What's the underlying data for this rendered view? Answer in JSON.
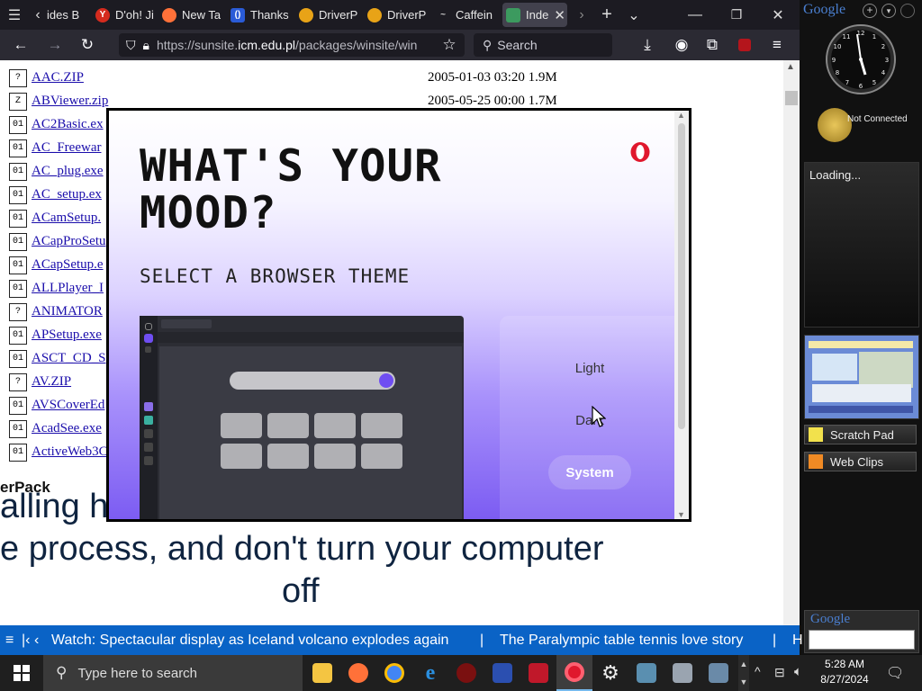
{
  "browser": {
    "tabs": [
      {
        "label": "ides B",
        "icon": "list-icon",
        "color": "#555555"
      },
      {
        "label": "D'oh! Ji",
        "icon": "yandex-icon",
        "color": "#d52b1e"
      },
      {
        "label": "New Ta",
        "icon": "firefox-icon",
        "color": "#ff7139"
      },
      {
        "label": "Thanks",
        "icon": "site-icon",
        "color": "#2a5bd7"
      },
      {
        "label": "DriverP",
        "icon": "driverpack-icon",
        "color": "#e8a317"
      },
      {
        "label": "DriverP",
        "icon": "driverpack-icon",
        "color": "#e8a317"
      },
      {
        "label": "Caffein",
        "icon": "coffee-icon",
        "color": "#444444"
      },
      {
        "label": "Inde",
        "icon": "image-icon",
        "color": "#3c9a5f",
        "active": true
      }
    ],
    "url_prefix": "https://sunsite.",
    "url_domain": "icm.edu.pl",
    "url_path": "/packages/winsite/win",
    "search_placeholder": "Search"
  },
  "listing": [
    {
      "name": "AAC.ZIP",
      "meta": "2005-01-03 03:20  1.9M",
      "icon": "?"
    },
    {
      "name": "ABViewer.zip",
      "meta": "2005-05-25 00:00  1.7M",
      "icon": "Z"
    },
    {
      "name": "AC2Basic.ex",
      "meta": "",
      "icon": "01"
    },
    {
      "name": "AC_Freewar",
      "meta": "",
      "icon": "01"
    },
    {
      "name": "AC_plug.exe",
      "meta": "",
      "icon": "01"
    },
    {
      "name": "AC_setup.ex",
      "meta": "",
      "icon": "01"
    },
    {
      "name": "ACamSetup.",
      "meta": "",
      "icon": "01"
    },
    {
      "name": "ACapProSetu",
      "meta": "",
      "icon": "01"
    },
    {
      "name": "ACapSetup.e",
      "meta": "",
      "icon": "01"
    },
    {
      "name": "ALLPlayer_I",
      "meta": "",
      "icon": "01"
    },
    {
      "name": "ANIMATOR",
      "meta": "",
      "icon": "?"
    },
    {
      "name": "APSetup.exe",
      "meta": "",
      "icon": "01"
    },
    {
      "name": "ASCT_CD_S",
      "meta": "",
      "icon": "01"
    },
    {
      "name": "AV.ZIP",
      "meta": "",
      "icon": "?"
    },
    {
      "name": "AVSCoverEd",
      "meta": "",
      "icon": "01"
    },
    {
      "name": "AcadSee.exe",
      "meta": "",
      "icon": "01"
    },
    {
      "name": "ActiveWeb3C",
      "meta": "",
      "icon": "01"
    }
  ],
  "page_text": {
    "small": "erPack",
    "line1": "alling h",
    "line2": "e process, and don't turn your computer",
    "line3": "off"
  },
  "modal": {
    "title": "WHAT'S YOUR MOOD?",
    "subtitle": "SELECT A BROWSER THEME",
    "options": [
      "Light",
      "Dark",
      "System"
    ],
    "selected": "System",
    "accent": "#7c5cf2"
  },
  "sidebar": {
    "title": "Google",
    "weather_status": "Not Connected",
    "loading": "Loading...",
    "scratch_pad": "Scratch Pad",
    "web_clips": "Web Clips",
    "search_logo": "Google"
  },
  "ticker": {
    "items": [
      "Watch: Spectacular display as Iceland volcano explodes again",
      "The Paralympic table tennis love story",
      "H"
    ]
  },
  "taskbar": {
    "search_placeholder": "Type here to search",
    "time": "5:28 AM",
    "date": "8/27/2024"
  }
}
